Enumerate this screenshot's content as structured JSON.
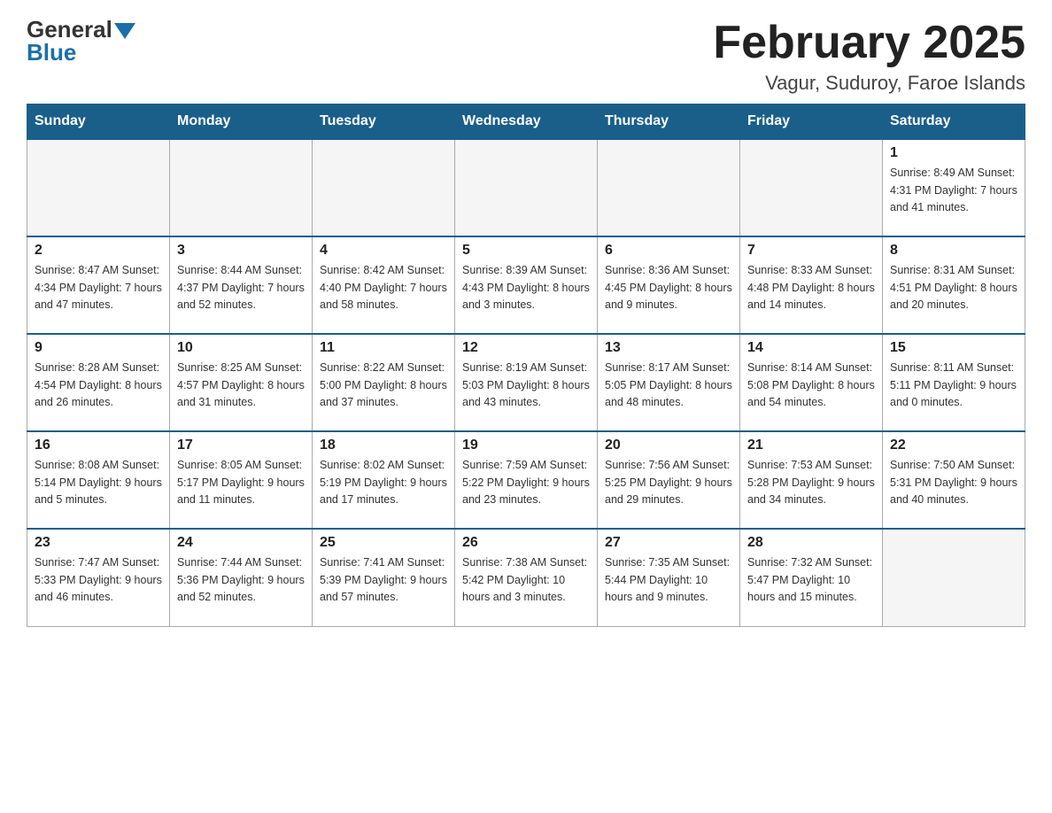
{
  "header": {
    "title": "February 2025",
    "location": "Vagur, Suduroy, Faroe Islands",
    "logo_general": "General",
    "logo_blue": "Blue"
  },
  "weekdays": [
    "Sunday",
    "Monday",
    "Tuesday",
    "Wednesday",
    "Thursday",
    "Friday",
    "Saturday"
  ],
  "weeks": [
    [
      {
        "day": "",
        "info": ""
      },
      {
        "day": "",
        "info": ""
      },
      {
        "day": "",
        "info": ""
      },
      {
        "day": "",
        "info": ""
      },
      {
        "day": "",
        "info": ""
      },
      {
        "day": "",
        "info": ""
      },
      {
        "day": "1",
        "info": "Sunrise: 8:49 AM\nSunset: 4:31 PM\nDaylight: 7 hours\nand 41 minutes."
      }
    ],
    [
      {
        "day": "2",
        "info": "Sunrise: 8:47 AM\nSunset: 4:34 PM\nDaylight: 7 hours\nand 47 minutes."
      },
      {
        "day": "3",
        "info": "Sunrise: 8:44 AM\nSunset: 4:37 PM\nDaylight: 7 hours\nand 52 minutes."
      },
      {
        "day": "4",
        "info": "Sunrise: 8:42 AM\nSunset: 4:40 PM\nDaylight: 7 hours\nand 58 minutes."
      },
      {
        "day": "5",
        "info": "Sunrise: 8:39 AM\nSunset: 4:43 PM\nDaylight: 8 hours\nand 3 minutes."
      },
      {
        "day": "6",
        "info": "Sunrise: 8:36 AM\nSunset: 4:45 PM\nDaylight: 8 hours\nand 9 minutes."
      },
      {
        "day": "7",
        "info": "Sunrise: 8:33 AM\nSunset: 4:48 PM\nDaylight: 8 hours\nand 14 minutes."
      },
      {
        "day": "8",
        "info": "Sunrise: 8:31 AM\nSunset: 4:51 PM\nDaylight: 8 hours\nand 20 minutes."
      }
    ],
    [
      {
        "day": "9",
        "info": "Sunrise: 8:28 AM\nSunset: 4:54 PM\nDaylight: 8 hours\nand 26 minutes."
      },
      {
        "day": "10",
        "info": "Sunrise: 8:25 AM\nSunset: 4:57 PM\nDaylight: 8 hours\nand 31 minutes."
      },
      {
        "day": "11",
        "info": "Sunrise: 8:22 AM\nSunset: 5:00 PM\nDaylight: 8 hours\nand 37 minutes."
      },
      {
        "day": "12",
        "info": "Sunrise: 8:19 AM\nSunset: 5:03 PM\nDaylight: 8 hours\nand 43 minutes."
      },
      {
        "day": "13",
        "info": "Sunrise: 8:17 AM\nSunset: 5:05 PM\nDaylight: 8 hours\nand 48 minutes."
      },
      {
        "day": "14",
        "info": "Sunrise: 8:14 AM\nSunset: 5:08 PM\nDaylight: 8 hours\nand 54 minutes."
      },
      {
        "day": "15",
        "info": "Sunrise: 8:11 AM\nSunset: 5:11 PM\nDaylight: 9 hours\nand 0 minutes."
      }
    ],
    [
      {
        "day": "16",
        "info": "Sunrise: 8:08 AM\nSunset: 5:14 PM\nDaylight: 9 hours\nand 5 minutes."
      },
      {
        "day": "17",
        "info": "Sunrise: 8:05 AM\nSunset: 5:17 PM\nDaylight: 9 hours\nand 11 minutes."
      },
      {
        "day": "18",
        "info": "Sunrise: 8:02 AM\nSunset: 5:19 PM\nDaylight: 9 hours\nand 17 minutes."
      },
      {
        "day": "19",
        "info": "Sunrise: 7:59 AM\nSunset: 5:22 PM\nDaylight: 9 hours\nand 23 minutes."
      },
      {
        "day": "20",
        "info": "Sunrise: 7:56 AM\nSunset: 5:25 PM\nDaylight: 9 hours\nand 29 minutes."
      },
      {
        "day": "21",
        "info": "Sunrise: 7:53 AM\nSunset: 5:28 PM\nDaylight: 9 hours\nand 34 minutes."
      },
      {
        "day": "22",
        "info": "Sunrise: 7:50 AM\nSunset: 5:31 PM\nDaylight: 9 hours\nand 40 minutes."
      }
    ],
    [
      {
        "day": "23",
        "info": "Sunrise: 7:47 AM\nSunset: 5:33 PM\nDaylight: 9 hours\nand 46 minutes."
      },
      {
        "day": "24",
        "info": "Sunrise: 7:44 AM\nSunset: 5:36 PM\nDaylight: 9 hours\nand 52 minutes."
      },
      {
        "day": "25",
        "info": "Sunrise: 7:41 AM\nSunset: 5:39 PM\nDaylight: 9 hours\nand 57 minutes."
      },
      {
        "day": "26",
        "info": "Sunrise: 7:38 AM\nSunset: 5:42 PM\nDaylight: 10 hours\nand 3 minutes."
      },
      {
        "day": "27",
        "info": "Sunrise: 7:35 AM\nSunset: 5:44 PM\nDaylight: 10 hours\nand 9 minutes."
      },
      {
        "day": "28",
        "info": "Sunrise: 7:32 AM\nSunset: 5:47 PM\nDaylight: 10 hours\nand 15 minutes."
      },
      {
        "day": "",
        "info": ""
      }
    ]
  ]
}
